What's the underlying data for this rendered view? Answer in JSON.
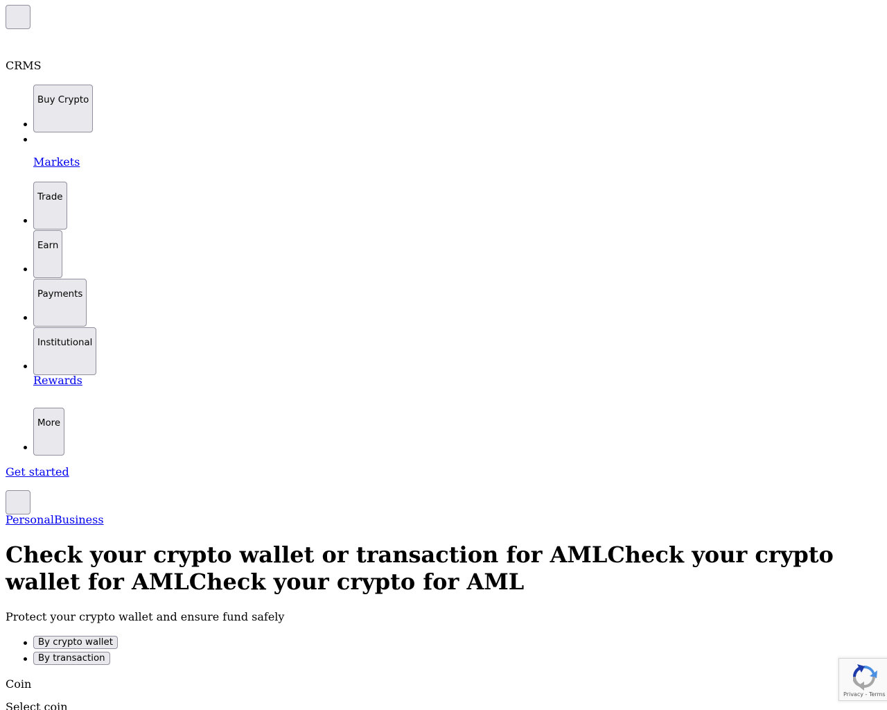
{
  "header": {
    "logo_text": "CRMS",
    "nav": [
      {
        "type": "button",
        "label": "Buy Crypto"
      },
      {
        "type": "link",
        "label": "Markets"
      },
      {
        "type": "button",
        "label": "Trade"
      },
      {
        "type": "button",
        "label": "Earn"
      },
      {
        "type": "button",
        "label": "Payments"
      },
      {
        "type": "button",
        "label": "Institutional"
      },
      {
        "type": "link",
        "label": "Rewards"
      },
      {
        "type": "button",
        "label": "More"
      }
    ],
    "get_started": "Get started",
    "segment_personal": "Personal",
    "segment_business": "Business"
  },
  "hero": {
    "title": "Check your crypto wallet or transaction for AMLCheck your crypto wallet for AMLCheck your crypto for AML",
    "subtitle": "Protect your crypto wallet and ensure fund safely"
  },
  "mode_tabs": {
    "by_wallet": "By crypto wallet",
    "by_transaction": "By transaction"
  },
  "form": {
    "coin_label": "Coin",
    "coin_placeholder": "Select coin"
  },
  "recaptcha": {
    "privacy": "Privacy",
    "separator": " - ",
    "terms": "Terms",
    "colors": {
      "blue": "#4a90e2",
      "dark_blue": "#1c3aa9",
      "gray": "#a6a6a6"
    }
  }
}
